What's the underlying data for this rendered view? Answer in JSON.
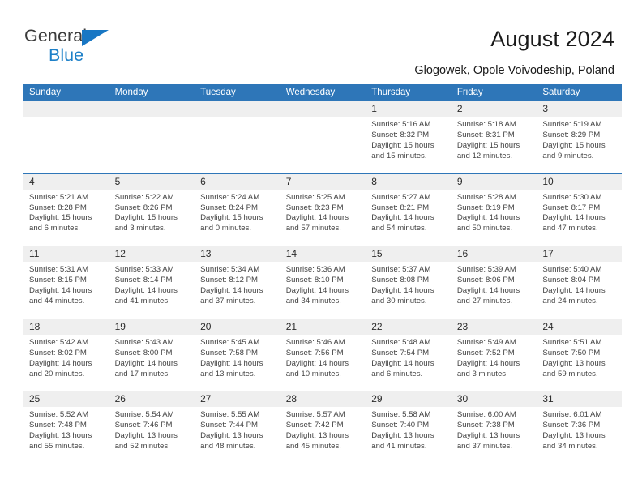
{
  "brand": {
    "name_part1": "General",
    "name_part2": "Blue",
    "triangle_icon": "triangle-icon",
    "accent_blue": "#1d80c8"
  },
  "header": {
    "title": "August 2024",
    "subtitle": "Glogowek, Opole Voivodeship, Poland"
  },
  "calendar": {
    "header_bg": "#2e76b8",
    "date_band_bg": "#efefef",
    "weekdays": [
      "Sunday",
      "Monday",
      "Tuesday",
      "Wednesday",
      "Thursday",
      "Friday",
      "Saturday"
    ],
    "weeks": [
      [
        {
          "day": "",
          "sunrise": "",
          "sunset": "",
          "daylight_1": "",
          "daylight_2": ""
        },
        {
          "day": "",
          "sunrise": "",
          "sunset": "",
          "daylight_1": "",
          "daylight_2": ""
        },
        {
          "day": "",
          "sunrise": "",
          "sunset": "",
          "daylight_1": "",
          "daylight_2": ""
        },
        {
          "day": "",
          "sunrise": "",
          "sunset": "",
          "daylight_1": "",
          "daylight_2": ""
        },
        {
          "day": "1",
          "sunrise": "Sunrise: 5:16 AM",
          "sunset": "Sunset: 8:32 PM",
          "daylight_1": "Daylight: 15 hours",
          "daylight_2": "and 15 minutes."
        },
        {
          "day": "2",
          "sunrise": "Sunrise: 5:18 AM",
          "sunset": "Sunset: 8:31 PM",
          "daylight_1": "Daylight: 15 hours",
          "daylight_2": "and 12 minutes."
        },
        {
          "day": "3",
          "sunrise": "Sunrise: 5:19 AM",
          "sunset": "Sunset: 8:29 PM",
          "daylight_1": "Daylight: 15 hours",
          "daylight_2": "and 9 minutes."
        }
      ],
      [
        {
          "day": "4",
          "sunrise": "Sunrise: 5:21 AM",
          "sunset": "Sunset: 8:28 PM",
          "daylight_1": "Daylight: 15 hours",
          "daylight_2": "and 6 minutes."
        },
        {
          "day": "5",
          "sunrise": "Sunrise: 5:22 AM",
          "sunset": "Sunset: 8:26 PM",
          "daylight_1": "Daylight: 15 hours",
          "daylight_2": "and 3 minutes."
        },
        {
          "day": "6",
          "sunrise": "Sunrise: 5:24 AM",
          "sunset": "Sunset: 8:24 PM",
          "daylight_1": "Daylight: 15 hours",
          "daylight_2": "and 0 minutes."
        },
        {
          "day": "7",
          "sunrise": "Sunrise: 5:25 AM",
          "sunset": "Sunset: 8:23 PM",
          "daylight_1": "Daylight: 14 hours",
          "daylight_2": "and 57 minutes."
        },
        {
          "day": "8",
          "sunrise": "Sunrise: 5:27 AM",
          "sunset": "Sunset: 8:21 PM",
          "daylight_1": "Daylight: 14 hours",
          "daylight_2": "and 54 minutes."
        },
        {
          "day": "9",
          "sunrise": "Sunrise: 5:28 AM",
          "sunset": "Sunset: 8:19 PM",
          "daylight_1": "Daylight: 14 hours",
          "daylight_2": "and 50 minutes."
        },
        {
          "day": "10",
          "sunrise": "Sunrise: 5:30 AM",
          "sunset": "Sunset: 8:17 PM",
          "daylight_1": "Daylight: 14 hours",
          "daylight_2": "and 47 minutes."
        }
      ],
      [
        {
          "day": "11",
          "sunrise": "Sunrise: 5:31 AM",
          "sunset": "Sunset: 8:15 PM",
          "daylight_1": "Daylight: 14 hours",
          "daylight_2": "and 44 minutes."
        },
        {
          "day": "12",
          "sunrise": "Sunrise: 5:33 AM",
          "sunset": "Sunset: 8:14 PM",
          "daylight_1": "Daylight: 14 hours",
          "daylight_2": "and 41 minutes."
        },
        {
          "day": "13",
          "sunrise": "Sunrise: 5:34 AM",
          "sunset": "Sunset: 8:12 PM",
          "daylight_1": "Daylight: 14 hours",
          "daylight_2": "and 37 minutes."
        },
        {
          "day": "14",
          "sunrise": "Sunrise: 5:36 AM",
          "sunset": "Sunset: 8:10 PM",
          "daylight_1": "Daylight: 14 hours",
          "daylight_2": "and 34 minutes."
        },
        {
          "day": "15",
          "sunrise": "Sunrise: 5:37 AM",
          "sunset": "Sunset: 8:08 PM",
          "daylight_1": "Daylight: 14 hours",
          "daylight_2": "and 30 minutes."
        },
        {
          "day": "16",
          "sunrise": "Sunrise: 5:39 AM",
          "sunset": "Sunset: 8:06 PM",
          "daylight_1": "Daylight: 14 hours",
          "daylight_2": "and 27 minutes."
        },
        {
          "day": "17",
          "sunrise": "Sunrise: 5:40 AM",
          "sunset": "Sunset: 8:04 PM",
          "daylight_1": "Daylight: 14 hours",
          "daylight_2": "and 24 minutes."
        }
      ],
      [
        {
          "day": "18",
          "sunrise": "Sunrise: 5:42 AM",
          "sunset": "Sunset: 8:02 PM",
          "daylight_1": "Daylight: 14 hours",
          "daylight_2": "and 20 minutes."
        },
        {
          "day": "19",
          "sunrise": "Sunrise: 5:43 AM",
          "sunset": "Sunset: 8:00 PM",
          "daylight_1": "Daylight: 14 hours",
          "daylight_2": "and 17 minutes."
        },
        {
          "day": "20",
          "sunrise": "Sunrise: 5:45 AM",
          "sunset": "Sunset: 7:58 PM",
          "daylight_1": "Daylight: 14 hours",
          "daylight_2": "and 13 minutes."
        },
        {
          "day": "21",
          "sunrise": "Sunrise: 5:46 AM",
          "sunset": "Sunset: 7:56 PM",
          "daylight_1": "Daylight: 14 hours",
          "daylight_2": "and 10 minutes."
        },
        {
          "day": "22",
          "sunrise": "Sunrise: 5:48 AM",
          "sunset": "Sunset: 7:54 PM",
          "daylight_1": "Daylight: 14 hours",
          "daylight_2": "and 6 minutes."
        },
        {
          "day": "23",
          "sunrise": "Sunrise: 5:49 AM",
          "sunset": "Sunset: 7:52 PM",
          "daylight_1": "Daylight: 14 hours",
          "daylight_2": "and 3 minutes."
        },
        {
          "day": "24",
          "sunrise": "Sunrise: 5:51 AM",
          "sunset": "Sunset: 7:50 PM",
          "daylight_1": "Daylight: 13 hours",
          "daylight_2": "and 59 minutes."
        }
      ],
      [
        {
          "day": "25",
          "sunrise": "Sunrise: 5:52 AM",
          "sunset": "Sunset: 7:48 PM",
          "daylight_1": "Daylight: 13 hours",
          "daylight_2": "and 55 minutes."
        },
        {
          "day": "26",
          "sunrise": "Sunrise: 5:54 AM",
          "sunset": "Sunset: 7:46 PM",
          "daylight_1": "Daylight: 13 hours",
          "daylight_2": "and 52 minutes."
        },
        {
          "day": "27",
          "sunrise": "Sunrise: 5:55 AM",
          "sunset": "Sunset: 7:44 PM",
          "daylight_1": "Daylight: 13 hours",
          "daylight_2": "and 48 minutes."
        },
        {
          "day": "28",
          "sunrise": "Sunrise: 5:57 AM",
          "sunset": "Sunset: 7:42 PM",
          "daylight_1": "Daylight: 13 hours",
          "daylight_2": "and 45 minutes."
        },
        {
          "day": "29",
          "sunrise": "Sunrise: 5:58 AM",
          "sunset": "Sunset: 7:40 PM",
          "daylight_1": "Daylight: 13 hours",
          "daylight_2": "and 41 minutes."
        },
        {
          "day": "30",
          "sunrise": "Sunrise: 6:00 AM",
          "sunset": "Sunset: 7:38 PM",
          "daylight_1": "Daylight: 13 hours",
          "daylight_2": "and 37 minutes."
        },
        {
          "day": "31",
          "sunrise": "Sunrise: 6:01 AM",
          "sunset": "Sunset: 7:36 PM",
          "daylight_1": "Daylight: 13 hours",
          "daylight_2": "and 34 minutes."
        }
      ]
    ]
  }
}
